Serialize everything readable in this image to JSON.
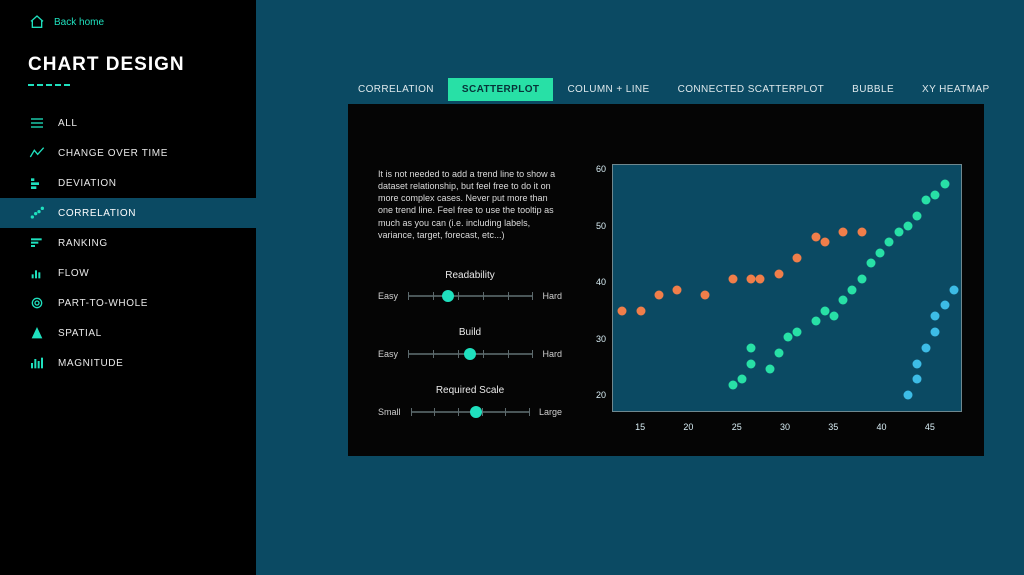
{
  "back_home": "Back home",
  "title": "CHART DESIGN",
  "nav": {
    "items": [
      {
        "label": "ALL",
        "icon": "all"
      },
      {
        "label": "CHANGE OVER TIME",
        "icon": "change"
      },
      {
        "label": "DEVIATION",
        "icon": "deviation"
      },
      {
        "label": "CORRELATION",
        "icon": "correlation",
        "active": true
      },
      {
        "label": "RANKING",
        "icon": "ranking"
      },
      {
        "label": "FLOW",
        "icon": "flow"
      },
      {
        "label": "PART-TO-WHOLE",
        "icon": "part"
      },
      {
        "label": "SPATIAL",
        "icon": "spatial"
      },
      {
        "label": "MAGNITUDE",
        "icon": "magnitude"
      }
    ]
  },
  "tabs": {
    "items": [
      {
        "label": "CORRELATION"
      },
      {
        "label": "SCATTERPLOT",
        "active": true
      },
      {
        "label": "COLUMN + LINE"
      },
      {
        "label": "CONNECTED SCATTERPLOT"
      },
      {
        "label": "BUBBLE"
      },
      {
        "label": "XY HEATMAP"
      }
    ]
  },
  "panel": {
    "description": "It is not needed to add a trend line to show a dataset relationship, but feel free to do it on more complex cases. Never put more than one trend line. Feel free to use the tooltip as much as you can (i.e. including labels, variance, target, forecast, etc...)",
    "sliders": [
      {
        "title": "Readability",
        "left": "Easy",
        "right": "Hard",
        "pos": 0.32
      },
      {
        "title": "Build",
        "left": "Easy",
        "right": "Hard",
        "pos": 0.5
      },
      {
        "title": "Required Scale",
        "left": "Small",
        "right": "Large",
        "pos": 0.55
      }
    ]
  },
  "chart_data": {
    "type": "scatter",
    "xlabel": "",
    "ylabel": "",
    "xlim": [
      12,
      50
    ],
    "ylim": [
      15,
      62
    ],
    "x_ticks": [
      15,
      20,
      25,
      30,
      35,
      40,
      45
    ],
    "y_ticks": [
      20,
      30,
      40,
      50,
      60
    ],
    "series": [
      {
        "name": "orange",
        "color": "#f07e4a",
        "points": [
          [
            13,
            34
          ],
          [
            15,
            34
          ],
          [
            17,
            37
          ],
          [
            19,
            38
          ],
          [
            22,
            37
          ],
          [
            25,
            40
          ],
          [
            27,
            40
          ],
          [
            28,
            40
          ],
          [
            30,
            41
          ],
          [
            32,
            44
          ],
          [
            34,
            48
          ],
          [
            35,
            47
          ],
          [
            37,
            49
          ],
          [
            39,
            49
          ]
        ]
      },
      {
        "name": "teal",
        "color": "#28e0a6",
        "points": [
          [
            25,
            20
          ],
          [
            26,
            21
          ],
          [
            27,
            24
          ],
          [
            27,
            27
          ],
          [
            29,
            23
          ],
          [
            30,
            26
          ],
          [
            31,
            29
          ],
          [
            32,
            30
          ],
          [
            34,
            32
          ],
          [
            35,
            34
          ],
          [
            36,
            33
          ],
          [
            37,
            36
          ],
          [
            38,
            38
          ],
          [
            39,
            40
          ],
          [
            40,
            43
          ],
          [
            41,
            45
          ],
          [
            42,
            47
          ],
          [
            43,
            49
          ],
          [
            44,
            50
          ],
          [
            45,
            52
          ],
          [
            46,
            55
          ],
          [
            47,
            56
          ],
          [
            48,
            58
          ]
        ]
      },
      {
        "name": "blue",
        "color": "#3dbce6",
        "points": [
          [
            44,
            18
          ],
          [
            45,
            21
          ],
          [
            45,
            24
          ],
          [
            46,
            27
          ],
          [
            47,
            30
          ],
          [
            47,
            33
          ],
          [
            48,
            35
          ],
          [
            49,
            38
          ]
        ]
      }
    ]
  }
}
